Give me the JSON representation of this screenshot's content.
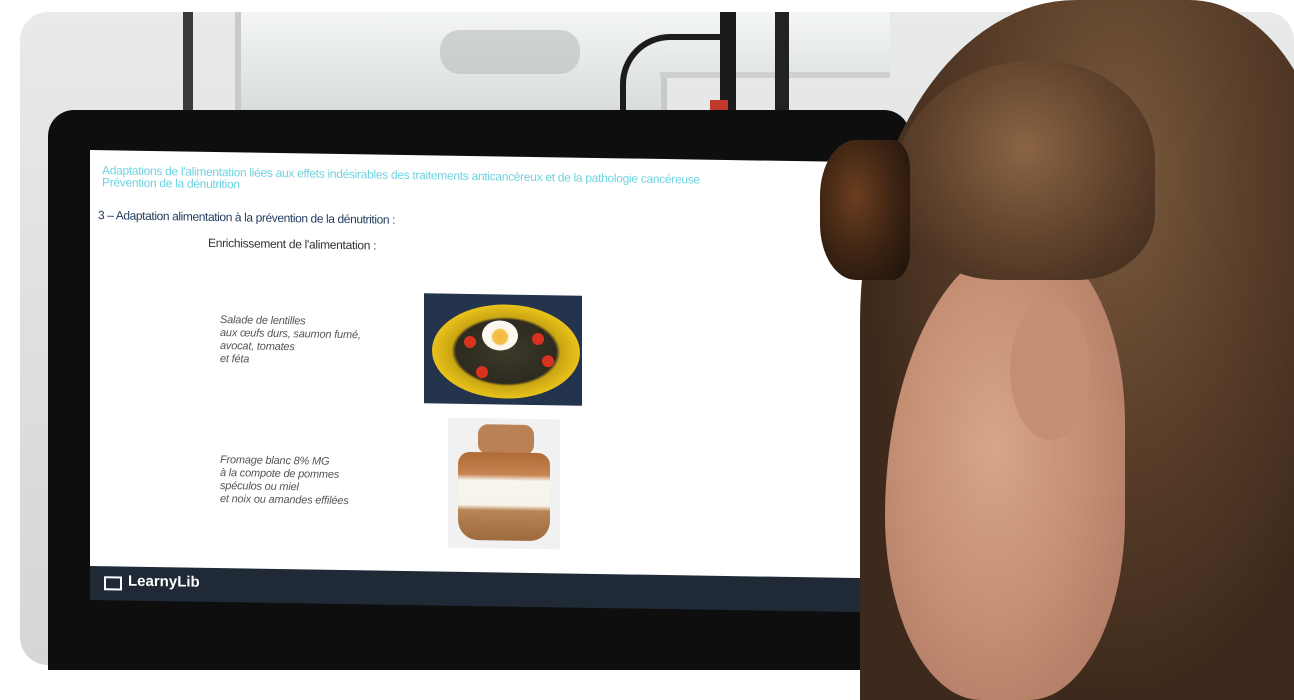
{
  "slide": {
    "header_line1": "Adaptations de l'alimentation liées aux effets indésirables des traitements anticancéreux et de la pathologie cancéreuse",
    "header_line2": "Prévention de la dénutrition",
    "heading": "3 – Adaptation alimentation à la prévention de la dénutrition :",
    "subheading": "Enrichissement de l'alimentation :",
    "caption1": [
      "Salade de lentilles",
      "aux œufs durs, saumon fumé,",
      "avocat, tomates",
      "et féta"
    ],
    "caption2": [
      "Fromage blanc 8% MG",
      "à la compote de pommes",
      "spéculos ou miel",
      "et noix ou amandes effilées"
    ]
  },
  "footer": {
    "brand": "LearnyLib"
  },
  "colors": {
    "header": "#6fd3df",
    "heading": "#1f3b5e",
    "footer_bar": "#1f2a36"
  }
}
